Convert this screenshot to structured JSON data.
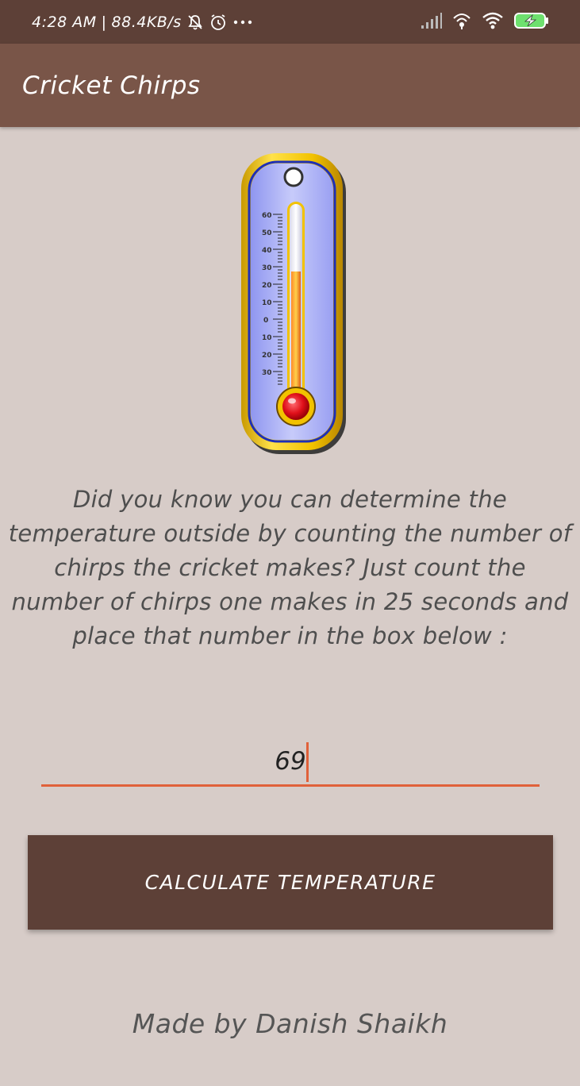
{
  "status_bar": {
    "time": "4:28 AM",
    "speed": "88.4KB/s",
    "icons": [
      "mute-icon",
      "alarm-icon",
      "more-icon",
      "signal-icon",
      "hotspot-icon",
      "wifi-icon",
      "battery-charging-icon"
    ]
  },
  "app_bar": {
    "title": "Cricket Chirps"
  },
  "thermometer": {
    "scale_labels": [
      "60",
      "50",
      "40",
      "30",
      "20",
      "10",
      "0",
      "10",
      "20",
      "30"
    ],
    "colors": {
      "frame": "#f2c200",
      "panel": "#a5aaf5",
      "mercury": "#e85a1a",
      "bulb": "#e0101a"
    }
  },
  "description": "Did you know you can determine the temperature outside by counting the number of chirps the cricket makes? Just count the number of chirps one makes in 25 seconds and place that number in the box below :",
  "chirp_input": {
    "value": "69"
  },
  "calculate_button": {
    "label": "CALCULATE TEMPERATURE"
  },
  "footer": {
    "text": "Made by Danish Shaikh"
  },
  "colors": {
    "background": "#d7ccc8",
    "status_bar": "#5d4037",
    "app_bar": "#795548",
    "button": "#5d4037",
    "accent": "#e0613a"
  }
}
